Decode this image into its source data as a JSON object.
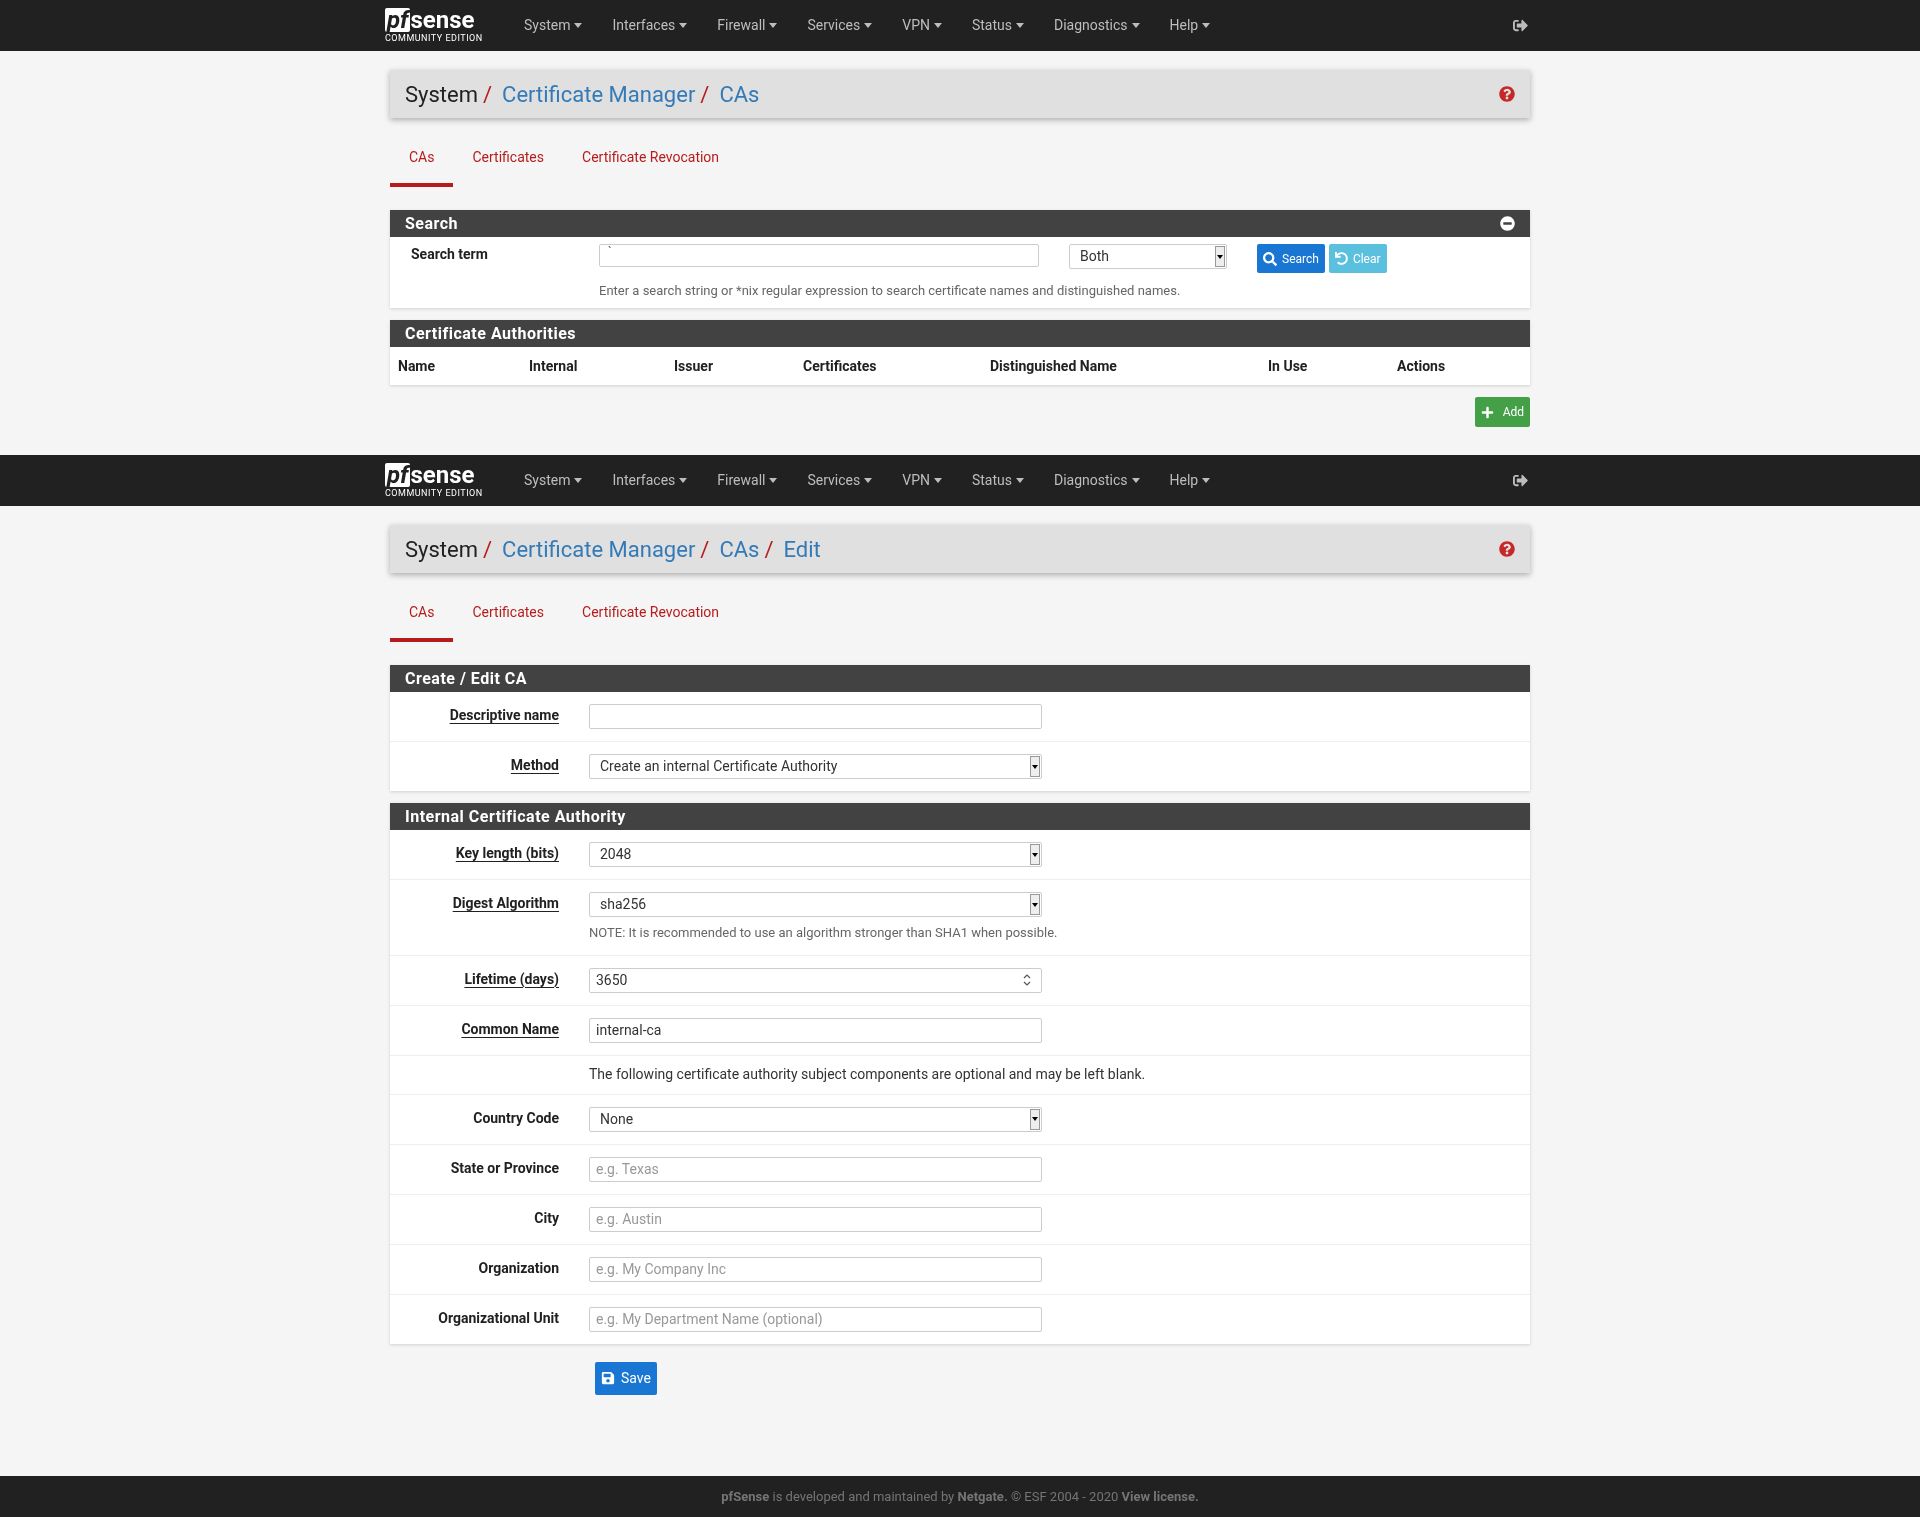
{
  "screens": [
    {
      "navbar": {
        "logo_prefix": "pf",
        "logo_name": "sense",
        "logo_edition": "COMMUNITY EDITION",
        "menu": [
          "System",
          "Interfaces",
          "Firewall",
          "Services",
          "VPN",
          "Status",
          "Diagnostics",
          "Help"
        ]
      },
      "breadcrumb": [
        {
          "label": "System",
          "kind": "plain",
          "separator": "/"
        },
        {
          "label": "Certificate Manager",
          "kind": "link",
          "separator": "/"
        },
        {
          "label": "CAs",
          "kind": "link"
        }
      ],
      "tabs": [
        {
          "label": "CAs",
          "selected": true
        },
        {
          "label": "Certificates",
          "selected": false
        },
        {
          "label": "Certificate Revocation",
          "selected": false
        }
      ],
      "search_panel": {
        "title": "Search",
        "label": "Search term",
        "value": "`",
        "scope": "Both",
        "search_button": "Search",
        "clear_button": "Clear",
        "help": "Enter a search string or *nix regular expression to search certificate names and distinguished names."
      },
      "table": {
        "title": "Certificate Authorities",
        "columns": [
          "Name",
          "Internal",
          "Issuer",
          "Certificates",
          "Distinguished Name",
          "In Use",
          "Actions"
        ]
      },
      "add_button": "Add"
    },
    {
      "navbar": {
        "logo_prefix": "pf",
        "logo_name": "sense",
        "logo_edition": "COMMUNITY EDITION",
        "menu": [
          "System",
          "Interfaces",
          "Firewall",
          "Services",
          "VPN",
          "Status",
          "Diagnostics",
          "Help"
        ]
      },
      "breadcrumb": [
        {
          "label": "System",
          "kind": "plain",
          "separator": "/"
        },
        {
          "label": "Certificate Manager",
          "kind": "link",
          "separator": "/"
        },
        {
          "label": "CAs",
          "kind": "link",
          "separator": "/"
        },
        {
          "label": "Edit",
          "kind": "link"
        }
      ],
      "tabs": [
        {
          "label": "CAs",
          "selected": true
        },
        {
          "label": "Certificates",
          "selected": false
        },
        {
          "label": "Certificate Revocation",
          "selected": false
        }
      ],
      "form": [
        {
          "title": "Create / Edit CA",
          "rows": [
            {
              "kind": "input",
              "label": "Descriptive name",
              "underlined": true
            },
            {
              "kind": "select",
              "label": "Method",
              "underlined": true,
              "value": "Create an internal Certificate Authority"
            }
          ]
        },
        {
          "title": "Internal Certificate Authority",
          "rows": [
            {
              "kind": "select",
              "label": "Key length (bits)",
              "underlined": true,
              "value": "2048"
            },
            {
              "kind": "select",
              "label": "Digest Algorithm",
              "underlined": true,
              "value": "sha256",
              "note": "NOTE: It is recommended to use an algorithm stronger than SHA1 when possible."
            },
            {
              "kind": "number",
              "label": "Lifetime (days)",
              "underlined": true,
              "value": "3650"
            },
            {
              "kind": "input",
              "label": "Common Name",
              "underlined": true,
              "value": "internal-ca"
            },
            {
              "kind": "info",
              "text": "The following certificate authority subject components are optional and may be left blank."
            },
            {
              "kind": "select",
              "label": "Country Code",
              "underlined": false,
              "value": "None"
            },
            {
              "kind": "input",
              "label": "State or Province",
              "underlined": false,
              "placeholder": "e.g. Texas"
            },
            {
              "kind": "input",
              "label": "City",
              "underlined": false,
              "placeholder": "e.g. Austin"
            },
            {
              "kind": "input",
              "label": "Organization",
              "underlined": false,
              "placeholder": "e.g. My Company Inc"
            },
            {
              "kind": "input",
              "label": "Organizational Unit",
              "underlined": false,
              "placeholder": "e.g. My Department Name (optional)"
            }
          ]
        }
      ],
      "save_button": "Save"
    }
  ],
  "footer": "**pfSense** is developed and maintained by **Netgate.** © ESF 2004 - 2020 **View license.**"
}
